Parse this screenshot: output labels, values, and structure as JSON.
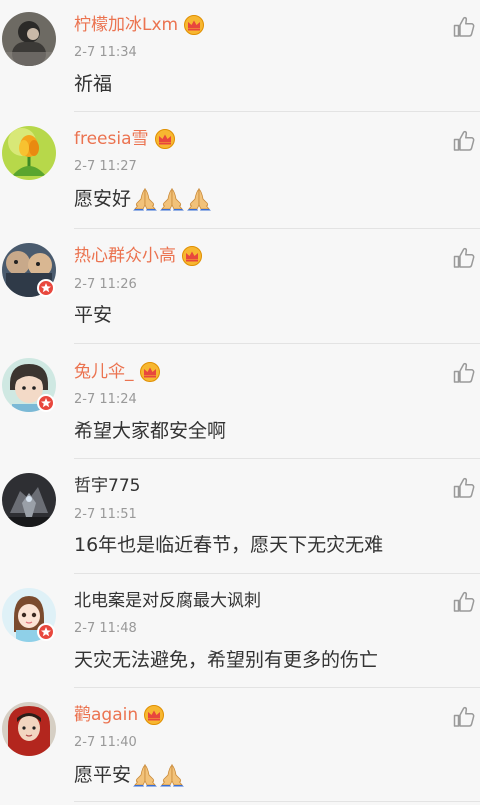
{
  "colors": {
    "vip_name": "#eb7350",
    "plain_name": "#333333",
    "time": "#999999",
    "text": "#333333",
    "badge": "#e8473d",
    "crown": "#f5a623"
  },
  "comments": [
    {
      "name": "柠檬加冰Lxm",
      "vip": true,
      "time": "2-7 11:34",
      "text": "祈福",
      "emoji": [],
      "avatar_icon": "avatar-icon",
      "verified": false
    },
    {
      "name": "freesia雪",
      "vip": true,
      "time": "2-7 11:27",
      "text": "愿安好",
      "emoji": [
        "praying-hands-icon",
        "praying-hands-icon",
        "praying-hands-icon"
      ],
      "avatar_icon": "avatar-icon",
      "verified": false
    },
    {
      "name": "热心群众小高",
      "vip": true,
      "time": "2-7 11:26",
      "text": "平安",
      "emoji": [],
      "avatar_icon": "avatar-icon",
      "verified": true
    },
    {
      "name": "兔儿伞_",
      "vip": true,
      "time": "2-7 11:24",
      "text": "希望大家都安全啊",
      "emoji": [],
      "avatar_icon": "avatar-icon",
      "verified": true
    },
    {
      "name": "哲宇775",
      "vip": false,
      "time": "2-7 11:51",
      "text": "16年也是临近春节，愿天下无灾无难",
      "emoji": [],
      "avatar_icon": "avatar-icon",
      "verified": false
    },
    {
      "name": "北电案是对反腐最大讽刺",
      "vip": false,
      "time": "2-7 11:48",
      "text": "天灾无法避免，希望别有更多的伤亡",
      "emoji": [],
      "avatar_icon": "avatar-icon",
      "verified": true
    },
    {
      "name": "鹳again",
      "vip": true,
      "time": "2-7 11:40",
      "text": "愿平安",
      "emoji": [
        "praying-hands-icon",
        "praying-hands-icon"
      ],
      "avatar_icon": "avatar-icon",
      "verified": false
    }
  ]
}
